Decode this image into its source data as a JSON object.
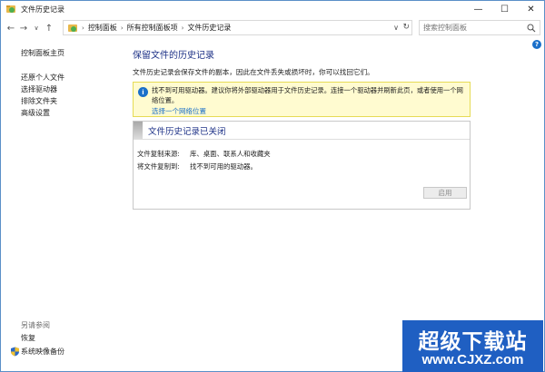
{
  "window": {
    "title": "文件历史记录",
    "buttons": {
      "minimize": "—",
      "maximize": "☐",
      "close": "✕"
    }
  },
  "addressbar": {
    "back": "←",
    "forward": "→",
    "recent": "∨",
    "up": "↑",
    "breadcrumbs": [
      "控制面板",
      "所有控制面板项",
      "文件历史记录"
    ],
    "separator": "›",
    "dropdown": "∨",
    "refresh": "↻",
    "search_placeholder": "搜索控制面板"
  },
  "help": "?",
  "sidebar": {
    "home": "控制面板主页",
    "items": [
      "还原个人文件",
      "选择驱动器",
      "排除文件夹",
      "高级设置"
    ]
  },
  "see_also": {
    "title": "另请参阅",
    "items": [
      "恢复",
      "系统映像备份"
    ]
  },
  "main": {
    "title": "保留文件的历史记录",
    "description": "文件历史记录会保存文件的副本，因此在文件丢失或损坏时，你可以找回它们。",
    "warning": {
      "icon": "i",
      "text": "找不到可用驱动器。建议你将外部驱动器用于文件历史记录。连接一个驱动器并刷新此页，或者使用一个网络位置。",
      "link": "选择一个网络位置"
    },
    "status_panel": {
      "title": "文件历史记录已关闭",
      "copy_from_label": "文件复制来源:",
      "copy_from_value": "库、桌面、联系人和收藏夹",
      "copy_to_label": "将文件复制到:",
      "copy_to_value": "找不到可用的驱动器。"
    },
    "enable_button": "启用"
  },
  "watermark": {
    "line1": "超级下载站",
    "line2": "www.CJXZ.com"
  },
  "colors": {
    "heading": "#1e3287",
    "link": "#1a6fc9",
    "warning_bg": "#fffbd0",
    "warning_border": "#e6db55",
    "watermark_bg": "#1f5fc2"
  }
}
